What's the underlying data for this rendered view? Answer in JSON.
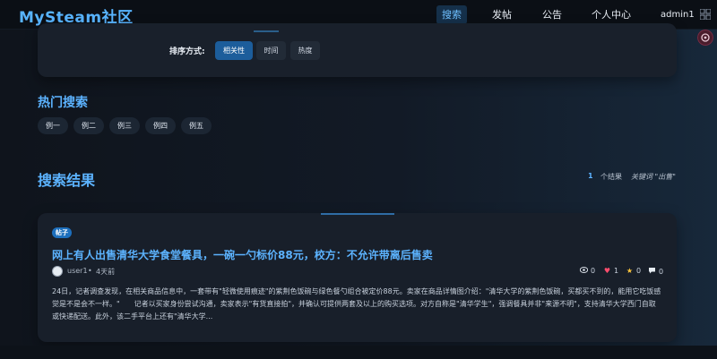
{
  "app": {
    "logo": "MySteam社区"
  },
  "nav": {
    "items": [
      {
        "label": "搜索",
        "active": true
      },
      {
        "label": "发帖",
        "active": false
      },
      {
        "label": "公告",
        "active": false
      },
      {
        "label": "个人中心",
        "active": false
      }
    ],
    "user": "admin1"
  },
  "sort": {
    "label": "排序方式:",
    "options": [
      {
        "label": "相关性",
        "active": true
      },
      {
        "label": "时间",
        "active": false
      },
      {
        "label": "热度",
        "active": false
      }
    ]
  },
  "hot": {
    "title": "热门搜索",
    "tags": [
      "例一",
      "例二",
      "例三",
      "例四",
      "例五"
    ]
  },
  "results": {
    "title": "搜索结果",
    "count": "1",
    "count_label": "个结果",
    "keyword_text": "关键词 \"出售\""
  },
  "post": {
    "badge": "帖子",
    "title": "网上有人出售清华大学食堂餐具，一碗一勺标价88元，校方：不允许带离后售卖",
    "author": "user1",
    "time": "4天前",
    "stats": {
      "views": "0",
      "likes": "1",
      "favorites": "0",
      "comments": "0"
    },
    "excerpt": "24日，记者调查发现，在相关商品信息中，一套带有\"轻微使用痕迹\"的紫荆色饭碗与绿色餐勺组合被定价88元。卖家在商品详情图介绍：\"清华大学的紫荆色饭碗，买都买不到的，能用它吃饭感觉是不是会不一样。\"　　记者以买家身份尝试沟通，卖家表示\"有货直接拍\"，并确认可提供两套及以上的购买选项。对方自称是\"清华学生\"，强调餐具并非\"来源不明\"，支持清华大学西门自取或快递配送。此外，该二手平台上还有\"清华大学..."
  },
  "colors": {
    "accent": "#5cb3ff",
    "active_button": "#1c5d9b",
    "badge": "#1d6fbd"
  }
}
